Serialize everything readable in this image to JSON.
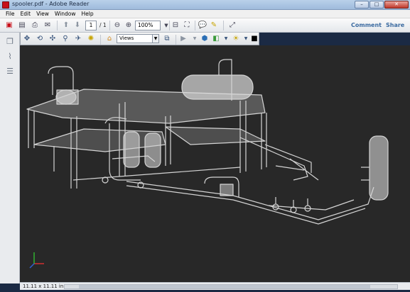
{
  "window": {
    "title": "spooler.pdf - Adobe Reader",
    "close_glyph": "✕",
    "min_glyph": "–",
    "max_glyph": "□"
  },
  "menu": [
    "File",
    "Edit",
    "View",
    "Window",
    "Help"
  ],
  "toolbar": {
    "page_current": "1",
    "page_total": "/ 1",
    "zoom": "100%",
    "comment_label": "Comment",
    "share_label": "Share"
  },
  "toolbar3d": {
    "views_label": "Views"
  },
  "status": {
    "page_size": "11.11 x 11.11 in"
  },
  "colors": {
    "viewport_bg": "#282828",
    "model_stroke": "#d8d8d8",
    "accent_red": "#c8101a",
    "link_blue": "#3a6aa0"
  }
}
